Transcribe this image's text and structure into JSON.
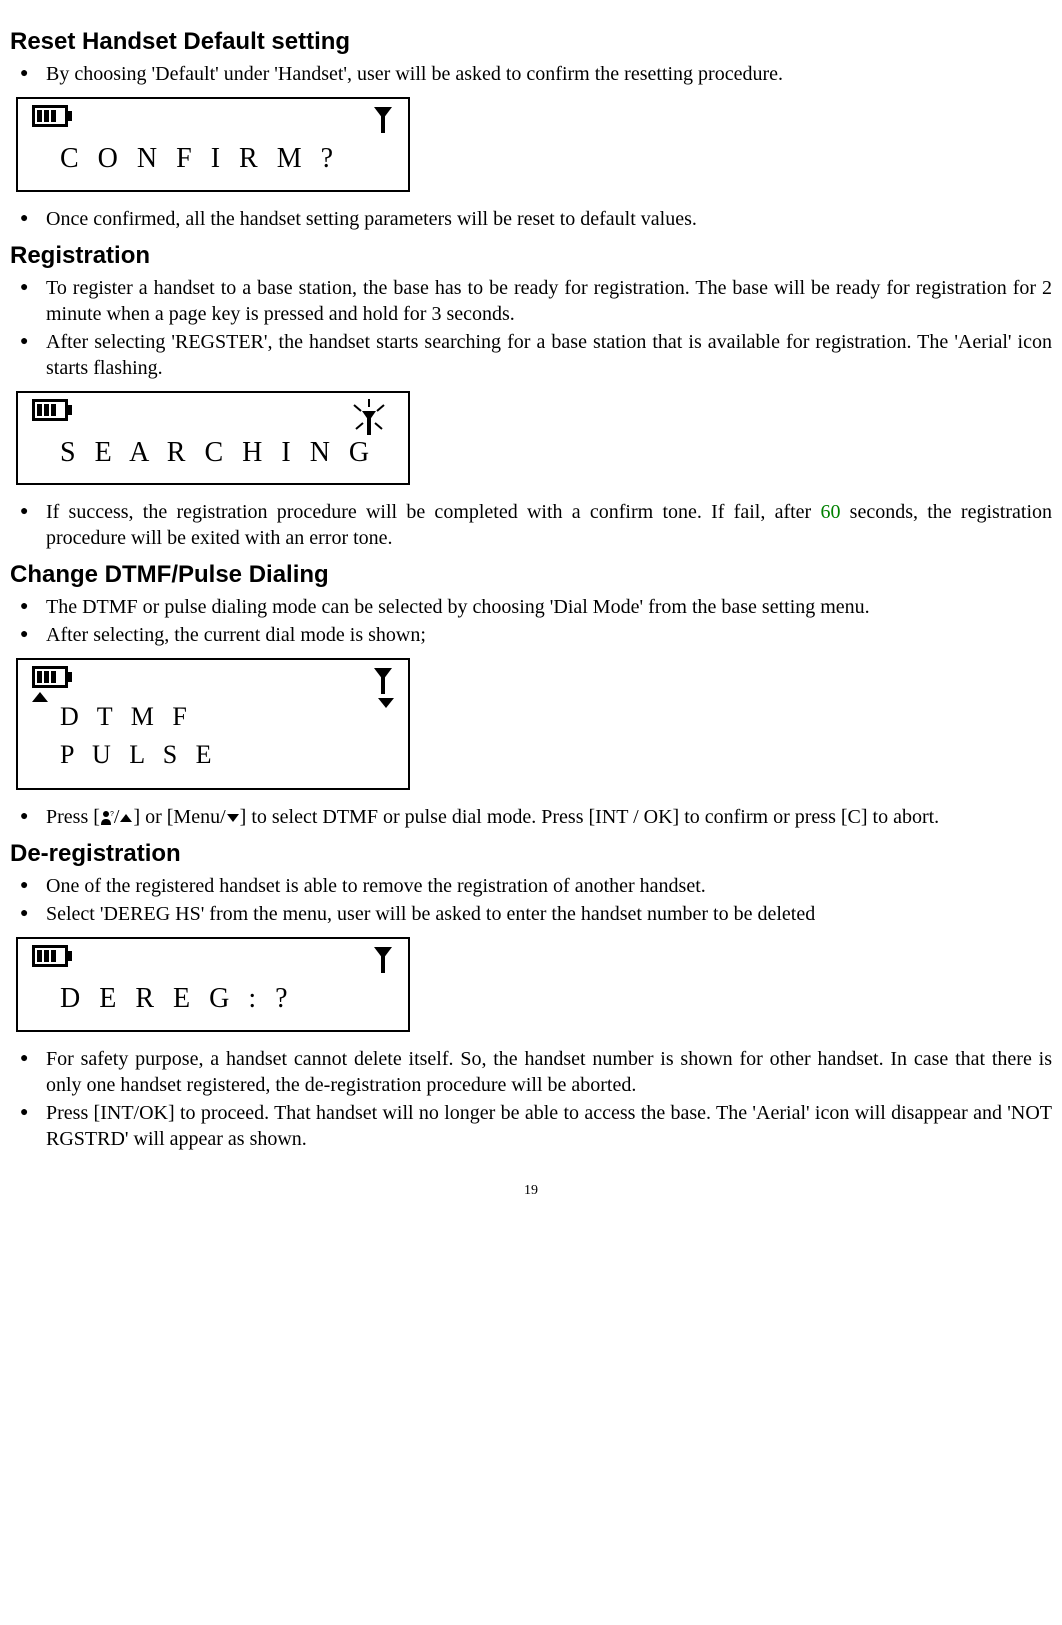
{
  "sections": {
    "reset": {
      "heading": "Reset Handset Default setting",
      "bullets": [
        "By choosing 'Default' under 'Handset', user will be asked to confirm the resetting procedure.",
        "Once confirmed, all the handset setting parameters will be reset to default values."
      ],
      "lcd_text": "C O N F I R M ?"
    },
    "registration": {
      "heading": "Registration",
      "bullets": [
        "To register a handset to a base station, the base has to be ready for registration. The base will be ready for registration for 2 minute when a page key is pressed and hold for 3 seconds.",
        "After selecting 'REGSTER', the handset starts searching for a base station that is available for registration. The 'Aerial' icon starts flashing."
      ],
      "lcd_text": "S E A R C H I N G",
      "bullet_after_pre": " If success, the registration procedure will be completed with a confirm tone. If fail, after ",
      "bullet_after_num": "60",
      "bullet_after_post": " seconds, the registration procedure will be exited with an error tone."
    },
    "dtmf": {
      "heading": "Change DTMF/Pulse Dialing",
      "bullets": [
        "The DTMF or pulse dialing mode can be selected by choosing 'Dial Mode' from the base setting menu.",
        "After selecting, the current dial mode is shown;"
      ],
      "lcd_line1": "D T M F",
      "lcd_line2": "P U L S E",
      "press_pre": "Press [",
      "press_mid1": "] or [Menu/",
      "press_mid2": "] to select DTMF or pulse dial mode. Press [INT / OK] to confirm or press [C] to abort."
    },
    "dereg": {
      "heading": "De-registration",
      "bullets": [
        "One of the registered handset is able to remove the registration of another handset.",
        "Select 'DEREG HS' from the menu, user will be asked to enter the handset number to be deleted"
      ],
      "lcd_text": "D E R E G :   ?",
      "bullets_after": [
        "For safety purpose, a handset cannot delete itself. So, the handset number is shown for other handset. In case that there is only one handset registered, the de-registration procedure will be aborted.",
        "Press [INT/OK] to proceed. That handset will no longer be able to access the base. The 'Aerial' icon will disappear and 'NOT RGSTRD' will appear as shown."
      ]
    }
  },
  "page_number": "19"
}
